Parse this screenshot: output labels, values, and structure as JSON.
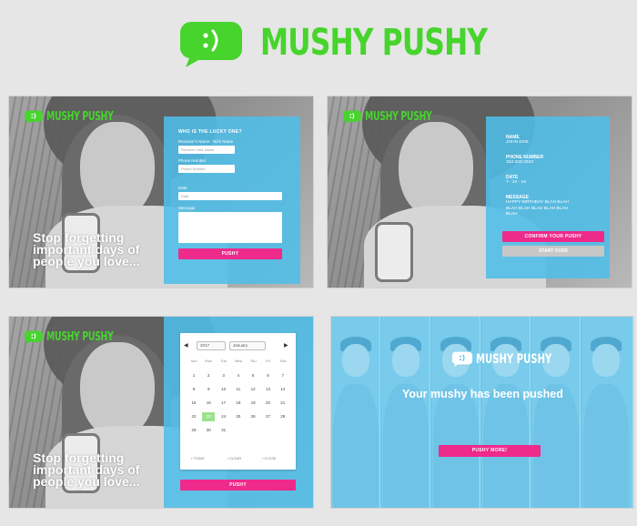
{
  "brand": {
    "name": "MUSHY PUSHY",
    "green": "#47d42d",
    "blue": "#50bee8",
    "pink": "#ee2a8b"
  },
  "tagline": "Stop forgetting important days of people you love...",
  "form": {
    "title": "WHO IS THE LUCKY ONE?",
    "recipient_label": "Receiver's Name - Nick Name",
    "recipient_placeholder": "Receiver Nick Name",
    "phone_label": "Phone Number",
    "phone_placeholder": "Phone Number",
    "date_label": "Date",
    "date_placeholder": "Date",
    "message_label": "Message",
    "submit": "PUSHY"
  },
  "confirm": {
    "name_label": "NAME",
    "name_value": "JOHN DOE",
    "phone_label": "PHONE NUMBER",
    "phone_value": "333-333-3333",
    "date_label": "DATE",
    "date_value": "7 - 24 - 16",
    "message_label": "MESSAGE",
    "message_value": "HAPPY BIRTHDAY BLAH BLAH BLAH BLAH BLAH BLAH BLAH BLAH",
    "confirm_button": "CONFIRM YOUR PUSHY",
    "start_over_button": "START OVER"
  },
  "calendar": {
    "year": "2017",
    "month": "January",
    "weekdays": [
      "Sun",
      "Mon",
      "Tue",
      "Wed",
      "Thu",
      "Fri",
      "Sat"
    ],
    "weeks": [
      [
        "",
        "",
        "",
        "",
        "",
        "",
        ""
      ],
      [
        "1",
        "2",
        "3",
        "4",
        "5",
        "6",
        "7"
      ],
      [
        "8",
        "9",
        "10",
        "11",
        "12",
        "13",
        "14"
      ],
      [
        "15",
        "16",
        "17",
        "18",
        "19",
        "20",
        "21"
      ],
      [
        "22",
        "23",
        "24",
        "25",
        "26",
        "27",
        "28"
      ],
      [
        "29",
        "30",
        "31",
        "",
        "",
        "",
        ""
      ]
    ],
    "selected": "23",
    "today_label": "TODAY",
    "clear_label": "CLEAR",
    "close_label": "CLOSE",
    "submit": "PUSHY"
  },
  "pushed": {
    "message": "Your mushy has been pushed",
    "button": "PUSHY MORE!"
  }
}
